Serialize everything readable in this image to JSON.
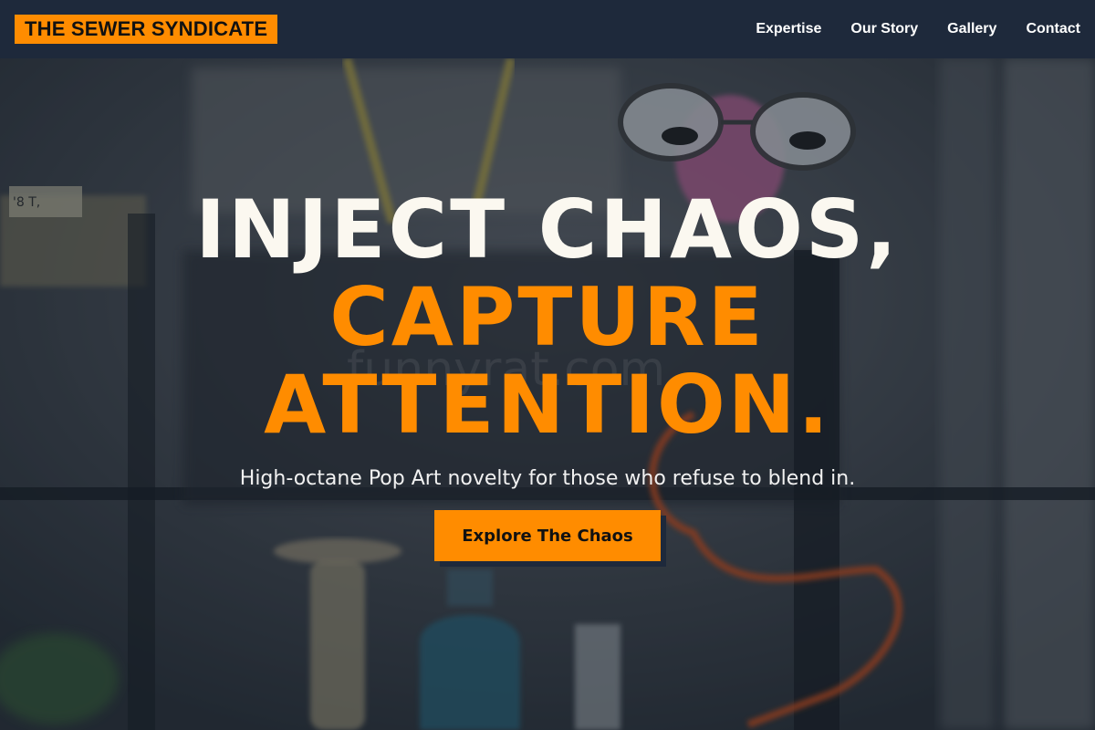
{
  "header": {
    "logo_text": "THE SEWER SYNDICATE",
    "nav": [
      {
        "label": "Expertise"
      },
      {
        "label": "Our Story"
      },
      {
        "label": "Gallery"
      },
      {
        "label": "Contact"
      }
    ]
  },
  "hero": {
    "headline_line1": "INJECT CHAOS,",
    "headline_line2": "CAPTURE",
    "headline_line3": "ATTENTION.",
    "subtitle": "High-octane Pop Art novelty for those who refuse to blend in.",
    "cta_label": "Explore The Chaos",
    "background_watermark": "funnyrat.com",
    "tile_letters": "'8  T,",
    "bg_image_description_icon": "novelty-shop-window-photo"
  },
  "colors": {
    "accent": "#ff8c00",
    "navbar": "#1e293b",
    "headline_white": "#fbf8f0"
  }
}
